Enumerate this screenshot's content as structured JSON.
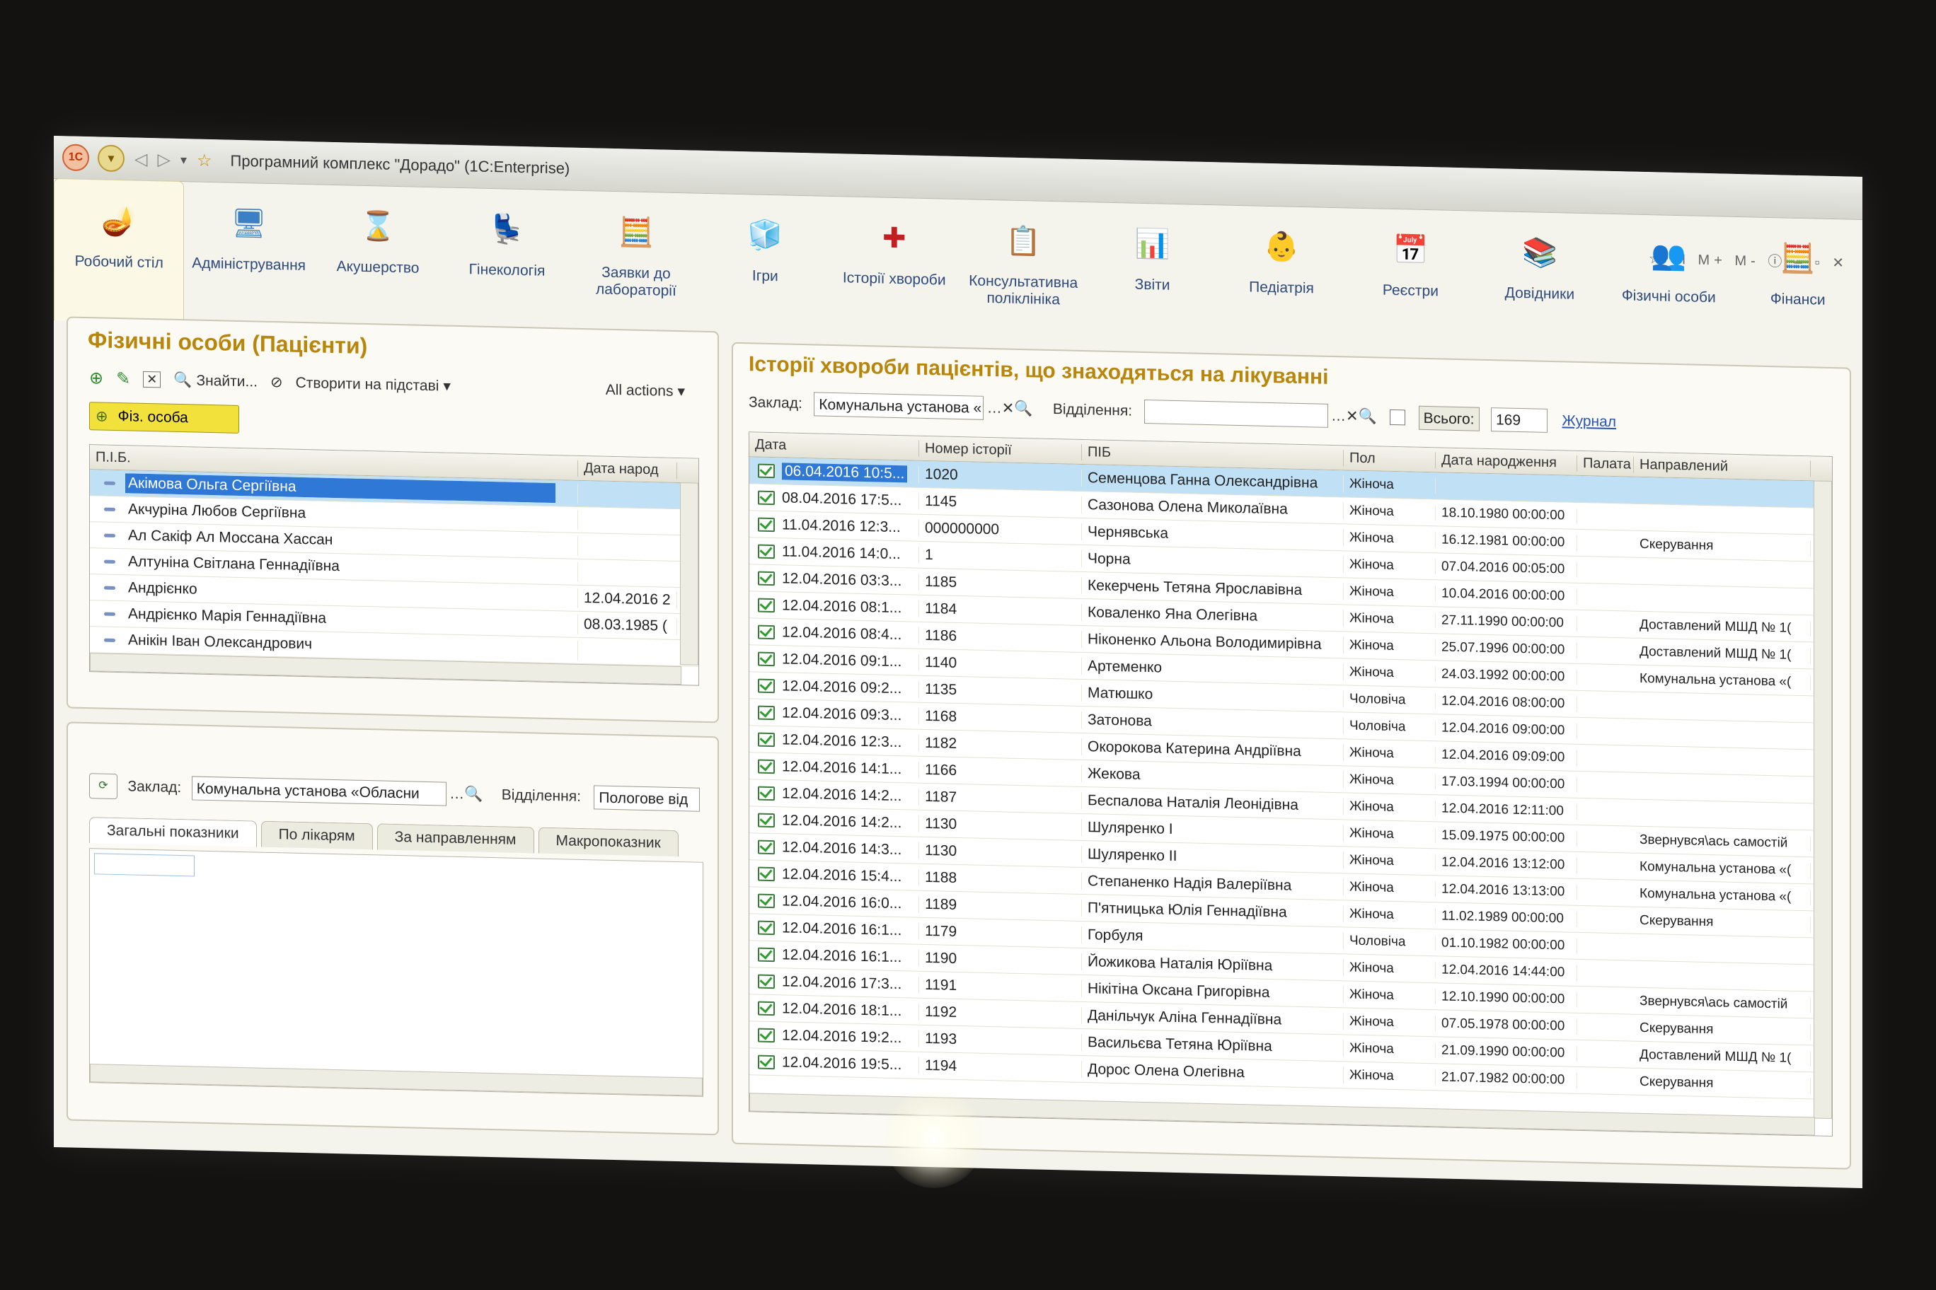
{
  "window": {
    "title": "Програмний комплекс \"Дорадо\"  (1С:Enterprise)",
    "controls": "M  M+  M-"
  },
  "ribbon": [
    {
      "label": "Робочий стіл",
      "icon": "desk-lamp-icon",
      "glyph": "🪔"
    },
    {
      "label": "Адміністрування",
      "icon": "admin-icon",
      "glyph": "🖥"
    },
    {
      "label": "Акушерство",
      "icon": "hourglass-icon",
      "glyph": "⌛"
    },
    {
      "label": "Гінекологія",
      "icon": "gyn-chair-icon",
      "glyph": "💺"
    },
    {
      "label": "Заявки до лабораторії",
      "icon": "lab-calculator-icon",
      "glyph": "🧮"
    },
    {
      "label": "Ігри",
      "icon": "cube-icon",
      "glyph": "🧊"
    },
    {
      "label": "Історії хвороби",
      "icon": "medical-folder-icon",
      "glyph": "✚"
    },
    {
      "label": "Консультативна поліклініка",
      "icon": "clinic-chart-icon",
      "glyph": "📋"
    },
    {
      "label": "Звіти",
      "icon": "reports-icon",
      "glyph": "📊"
    },
    {
      "label": "Педіатрія",
      "icon": "baby-icon",
      "glyph": "👶"
    },
    {
      "label": "Реєстри",
      "icon": "calendar-icon",
      "glyph": "📅"
    },
    {
      "label": "Довідники",
      "icon": "books-icon",
      "glyph": "📚"
    },
    {
      "label": "Фізичні особи",
      "icon": "people-icon",
      "glyph": "👥"
    },
    {
      "label": "Фінанси",
      "icon": "abacus-icon",
      "glyph": "🧮"
    }
  ],
  "left_panel": {
    "title": "Фізичні особи (Пацієнти)",
    "toolbar": {
      "find": "Знайти...",
      "create_based": "Створити на підставі",
      "all_actions": "All actions"
    },
    "yellow_button": "Фіз. особа",
    "columns": [
      "П.І.Б.",
      "Дата народ"
    ],
    "rows": [
      {
        "name": "Акімова Ольга Сергіївна",
        "date": ""
      },
      {
        "name": "Акчуріна Любов Сергіївна",
        "date": ""
      },
      {
        "name": "Ал Сакіф Ал Мосcана Хасcан",
        "date": ""
      },
      {
        "name": "Алтуніна Світлана Геннадіївна",
        "date": ""
      },
      {
        "name": "Андрієнко",
        "date": "12.04.2016 2"
      },
      {
        "name": "Андрієнко Марія Геннадіївна",
        "date": "08.03.1985 ("
      },
      {
        "name": "Анікін Іван Олександрович",
        "date": ""
      }
    ]
  },
  "bottom_panel": {
    "label_institution": "Заклад:",
    "institution_value": "Комунальна установа «Обласни",
    "label_department": "Відділення:",
    "department_value": "Пологове від",
    "tabs": [
      "Загальні показники",
      "По лікарям",
      "За направленням",
      "Макропоказник"
    ]
  },
  "right_panel": {
    "title": "Історії хвороби пацієнтів, що знаходяться на лікуванні",
    "label_institution": "Заклад:",
    "institution_value": "Комунальна установа «",
    "label_department": "Відділення:",
    "department_value": "",
    "total_label": "Всього:",
    "total_value": "169",
    "journal_link": "Журнал",
    "columns": [
      "Дата",
      "Номер історії",
      "ПІБ",
      "Пол",
      "Дата народження",
      "Палата",
      "Направлений"
    ],
    "rows": [
      {
        "date": "06.04.2016 10:5...",
        "num": "1020",
        "name": "Семенцова Ганна Олександрівна",
        "sex": "Жіноча",
        "birth": "",
        "ward": "",
        "dir": ""
      },
      {
        "date": "08.04.2016 17:5...",
        "num": "1145",
        "name": "Сазонова Олена Миколаївна",
        "sex": "Жіноча",
        "birth": "18.10.1980 00:00:00",
        "ward": "",
        "dir": ""
      },
      {
        "date": "11.04.2016 12:3...",
        "num": "000000000",
        "name": "Чернявська",
        "sex": "Жіноча",
        "birth": "16.12.1981 00:00:00",
        "ward": "",
        "dir": "Скерування"
      },
      {
        "date": "11.04.2016 14:0...",
        "num": "1",
        "name": "Чорна",
        "sex": "Жіноча",
        "birth": "07.04.2016 00:05:00",
        "ward": "",
        "dir": ""
      },
      {
        "date": "12.04.2016 03:3...",
        "num": "1185",
        "name": "Кекерчень Тетяна Ярославівна",
        "sex": "Жіноча",
        "birth": "10.04.2016 00:00:00",
        "ward": "",
        "dir": ""
      },
      {
        "date": "12.04.2016 08:1...",
        "num": "1184",
        "name": "Коваленко Яна Олегівна",
        "sex": "Жіноча",
        "birth": "27.11.1990 00:00:00",
        "ward": "",
        "dir": "Доставлений МШД № 1("
      },
      {
        "date": "12.04.2016 08:4...",
        "num": "1186",
        "name": "Ніконенко Альона Володимирівна",
        "sex": "Жіноча",
        "birth": "25.07.1996 00:00:00",
        "ward": "",
        "dir": "Доставлений МШД № 1("
      },
      {
        "date": "12.04.2016 09:1...",
        "num": "1140",
        "name": "Артеменко",
        "sex": "Жіноча",
        "birth": "24.03.1992 00:00:00",
        "ward": "",
        "dir": "Комунальна установа «("
      },
      {
        "date": "12.04.2016 09:2...",
        "num": "1135",
        "name": "Матюшко",
        "sex": "Чоловіча",
        "birth": "12.04.2016 08:00:00",
        "ward": "",
        "dir": ""
      },
      {
        "date": "12.04.2016 09:3...",
        "num": "1168",
        "name": "Затонова",
        "sex": "Чоловіча",
        "birth": "12.04.2016 09:00:00",
        "ward": "",
        "dir": ""
      },
      {
        "date": "12.04.2016 12:3...",
        "num": "1182",
        "name": "Окорокова Катерина Андріївна",
        "sex": "Жіноча",
        "birth": "12.04.2016 09:09:00",
        "ward": "",
        "dir": ""
      },
      {
        "date": "12.04.2016 14:1...",
        "num": "1166",
        "name": "Жекова",
        "sex": "Жіноча",
        "birth": "17.03.1994 00:00:00",
        "ward": "",
        "dir": ""
      },
      {
        "date": "12.04.2016 14:2...",
        "num": "1187",
        "name": "Беспалова Наталія Леонідівна",
        "sex": "Жіноча",
        "birth": "12.04.2016 12:11:00",
        "ward": "",
        "dir": ""
      },
      {
        "date": "12.04.2016 14:2...",
        "num": "1130",
        "name": "Шуляренко І",
        "sex": "Жіноча",
        "birth": "15.09.1975 00:00:00",
        "ward": "",
        "dir": "Звернувся\\ась самостій"
      },
      {
        "date": "12.04.2016 14:3...",
        "num": "1130",
        "name": "Шуляренко ІІ",
        "sex": "Жіноча",
        "birth": "12.04.2016 13:12:00",
        "ward": "",
        "dir": "Комунальна установа «("
      },
      {
        "date": "12.04.2016 15:4...",
        "num": "1188",
        "name": "Степаненко Надія Валеріївна",
        "sex": "Жіноча",
        "birth": "12.04.2016 13:13:00",
        "ward": "",
        "dir": "Комунальна установа «("
      },
      {
        "date": "12.04.2016 16:0...",
        "num": "1189",
        "name": "П'ятницька Юлія Геннадіївна",
        "sex": "Жіноча",
        "birth": "11.02.1989 00:00:00",
        "ward": "",
        "dir": "Скерування"
      },
      {
        "date": "12.04.2016 16:1...",
        "num": "1179",
        "name": "Горбуля",
        "sex": "Чоловіча",
        "birth": "01.10.1982 00:00:00",
        "ward": "",
        "dir": ""
      },
      {
        "date": "12.04.2016 16:1...",
        "num": "1190",
        "name": "Йожикова Наталія Юріївна",
        "sex": "Жіноча",
        "birth": "12.04.2016 14:44:00",
        "ward": "",
        "dir": ""
      },
      {
        "date": "12.04.2016 17:3...",
        "num": "1191",
        "name": "Нікітіна Оксана Григорівна",
        "sex": "Жіноча",
        "birth": "12.10.1990 00:00:00",
        "ward": "",
        "dir": "Звернувся\\ась самостій"
      },
      {
        "date": "12.04.2016 18:1...",
        "num": "1192",
        "name": "Данільчук Аліна Геннадіївна",
        "sex": "Жіноча",
        "birth": "07.05.1978 00:00:00",
        "ward": "",
        "dir": "Скерування"
      },
      {
        "date": "12.04.2016 19:2...",
        "num": "1193",
        "name": "Васильєва Тетяна Юріївна",
        "sex": "Жіноча",
        "birth": "21.09.1990 00:00:00",
        "ward": "",
        "dir": "Доставлений МШД № 1("
      },
      {
        "date": "12.04.2016 19:5...",
        "num": "1194",
        "name": "Дорос Олена Олегівна",
        "sex": "Жіноча",
        "birth": "21.07.1982 00:00:00",
        "ward": "",
        "dir": "Скерування"
      }
    ]
  }
}
